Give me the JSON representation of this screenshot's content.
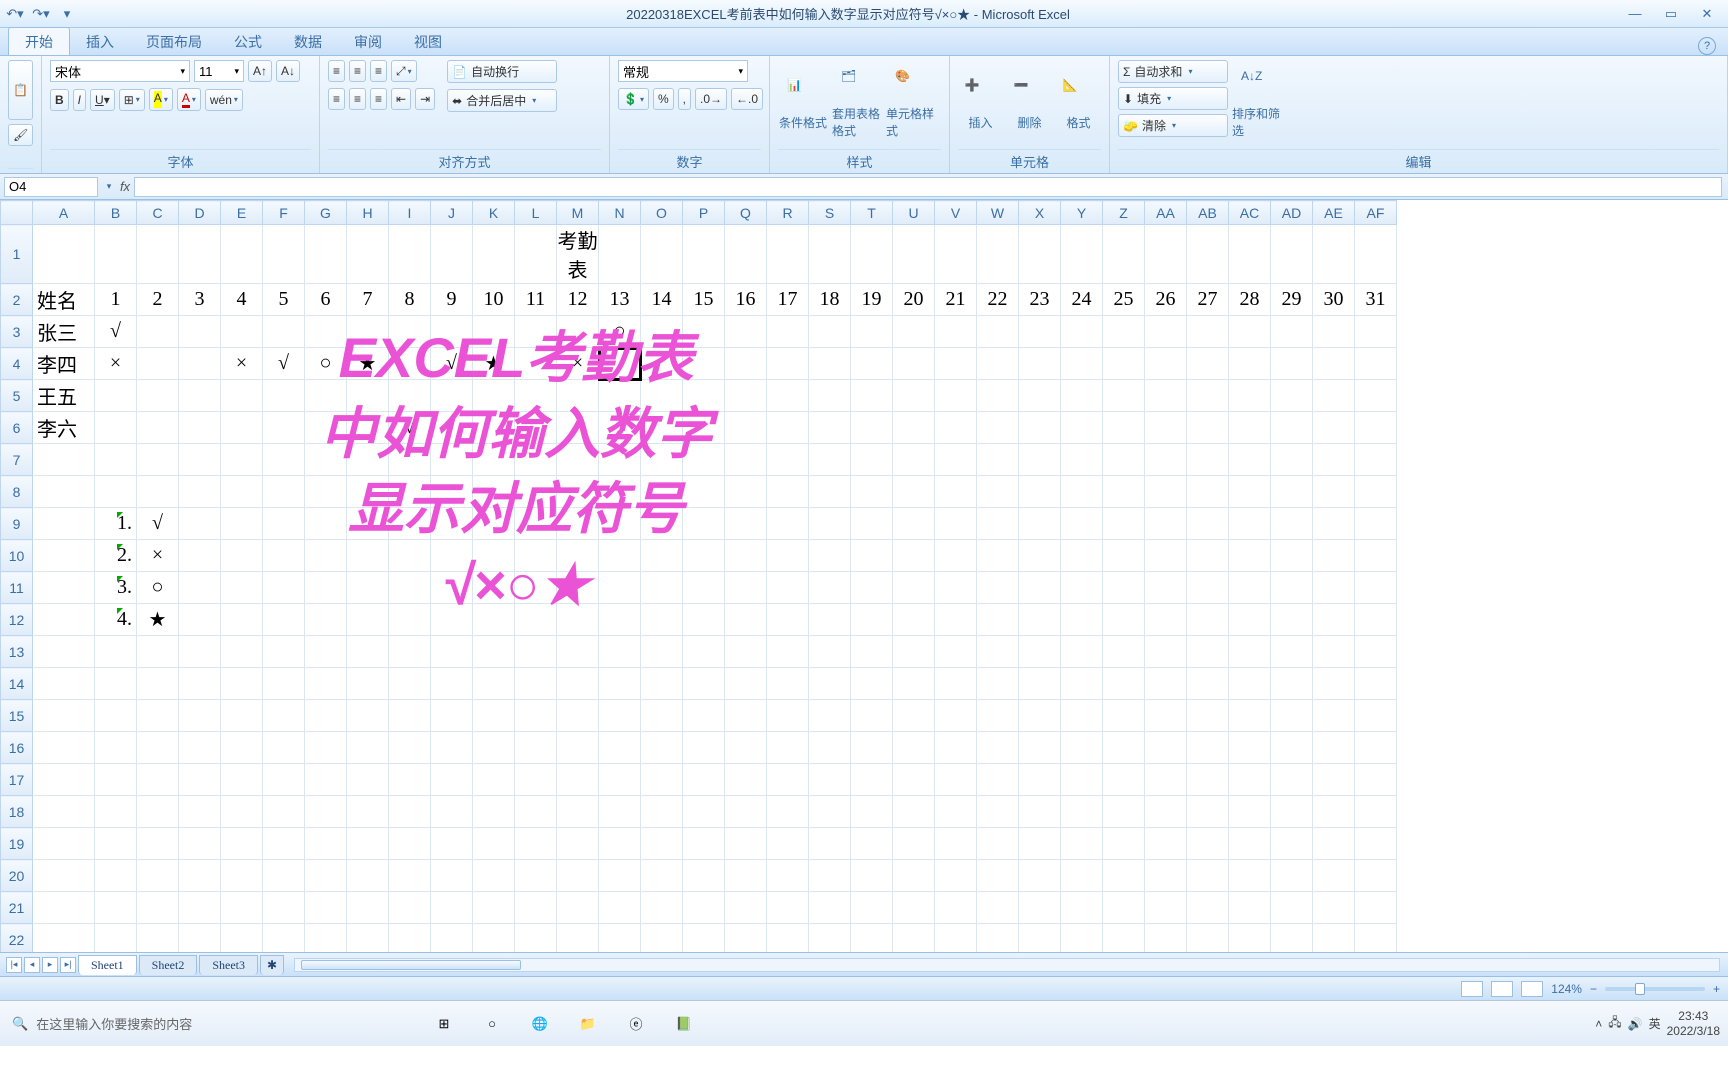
{
  "titlebar": {
    "title": "20220318EXCEL考前表中如何输入数字显示对应符号√×○★ - Microsoft Excel"
  },
  "tabs": {
    "t0": "开始",
    "t1": "插入",
    "t2": "页面布局",
    "t3": "公式",
    "t4": "数据",
    "t5": "审阅",
    "t6": "视图"
  },
  "ribbon": {
    "font_name": "宋体",
    "font_size": "11",
    "wrap": "自动换行",
    "merge": "合并后居中",
    "numfmt": "常规",
    "cond": "条件格式",
    "tblfmt": "套用表格格式",
    "cellstyle": "单元格样式",
    "insert": "插入",
    "delete": "删除",
    "format": "格式",
    "autosum": "自动求和",
    "fill": "填充",
    "clear": "清除",
    "sort": "排序和筛选",
    "g_font": "字体",
    "g_align": "对齐方式",
    "g_num": "数字",
    "g_style": "样式",
    "g_cell": "单元格",
    "g_edit": "编辑"
  },
  "namebox": "O4",
  "colHeaders": [
    "A",
    "B",
    "C",
    "D",
    "E",
    "F",
    "G",
    "H",
    "I",
    "J",
    "K",
    "L",
    "M",
    "N",
    "O",
    "P",
    "Q",
    "R",
    "S",
    "T",
    "U",
    "V",
    "W",
    "X",
    "Y",
    "Z",
    "AA",
    "AB",
    "AC",
    "AD",
    "AE",
    "AF"
  ],
  "sheet": {
    "title": "考勤表",
    "header_row": [
      "姓名",
      "1",
      "2",
      "3",
      "4",
      "5",
      "6",
      "7",
      "8",
      "9",
      "10",
      "11",
      "12",
      "13",
      "14",
      "15",
      "16",
      "17",
      "18",
      "19",
      "20",
      "21",
      "22",
      "23",
      "24",
      "25",
      "26",
      "27",
      "28",
      "29",
      "30",
      "31"
    ],
    "rows": [
      {
        "name": "张三",
        "cells": [
          "√",
          "",
          "",
          "",
          "",
          "",
          "",
          "",
          "",
          "",
          "",
          "",
          "○",
          "",
          "",
          "",
          "",
          "",
          "",
          "",
          "",
          "",
          "",
          "",
          "",
          "",
          "",
          "",
          "",
          "",
          ""
        ]
      },
      {
        "name": "李四",
        "cells": [
          "×",
          "",
          "",
          "×",
          "√",
          "○",
          "★",
          "",
          "√",
          "★",
          "",
          "×",
          "",
          "",
          "",
          "",
          "",
          "",
          "",
          "",
          "",
          "",
          "",
          "",
          "",
          "",
          "",
          "",
          "",
          "",
          ""
        ]
      },
      {
        "name": "王五",
        "cells": [
          "",
          "",
          "",
          "",
          "",
          "",
          "",
          "",
          "",
          "",
          "",
          "",
          "",
          "",
          "",
          "",
          "",
          "",
          "",
          "",
          "",
          "",
          "",
          "",
          "",
          "",
          "",
          "",
          "",
          "",
          ""
        ]
      },
      {
        "name": "李六",
        "cells": [
          "",
          "",
          "",
          "",
          "",
          "",
          "",
          "√",
          "",
          "",
          "",
          "",
          "",
          "",
          "",
          "",
          "",
          "",
          "",
          "",
          "",
          "",
          "",
          "",
          "",
          "",
          "",
          "",
          "",
          "",
          ""
        ]
      }
    ],
    "legend": [
      {
        "n": "1.",
        "s": "√"
      },
      {
        "n": "2.",
        "s": "×"
      },
      {
        "n": "3.",
        "s": "○"
      },
      {
        "n": "4.",
        "s": "★"
      }
    ]
  },
  "overlay": {
    "l1": "EXCEL考勤表",
    "l2": "中如何输入数字",
    "l3": "显示对应符号",
    "l4": "√×○★"
  },
  "sheetTabs": {
    "s1": "Sheet1",
    "s2": "Sheet2",
    "s3": "Sheet3"
  },
  "status": {
    "zoom": "124%"
  },
  "taskbar": {
    "search": "在这里输入你要搜索的内容",
    "ime": "英",
    "time": "23:43",
    "date": "2022/3/18"
  }
}
